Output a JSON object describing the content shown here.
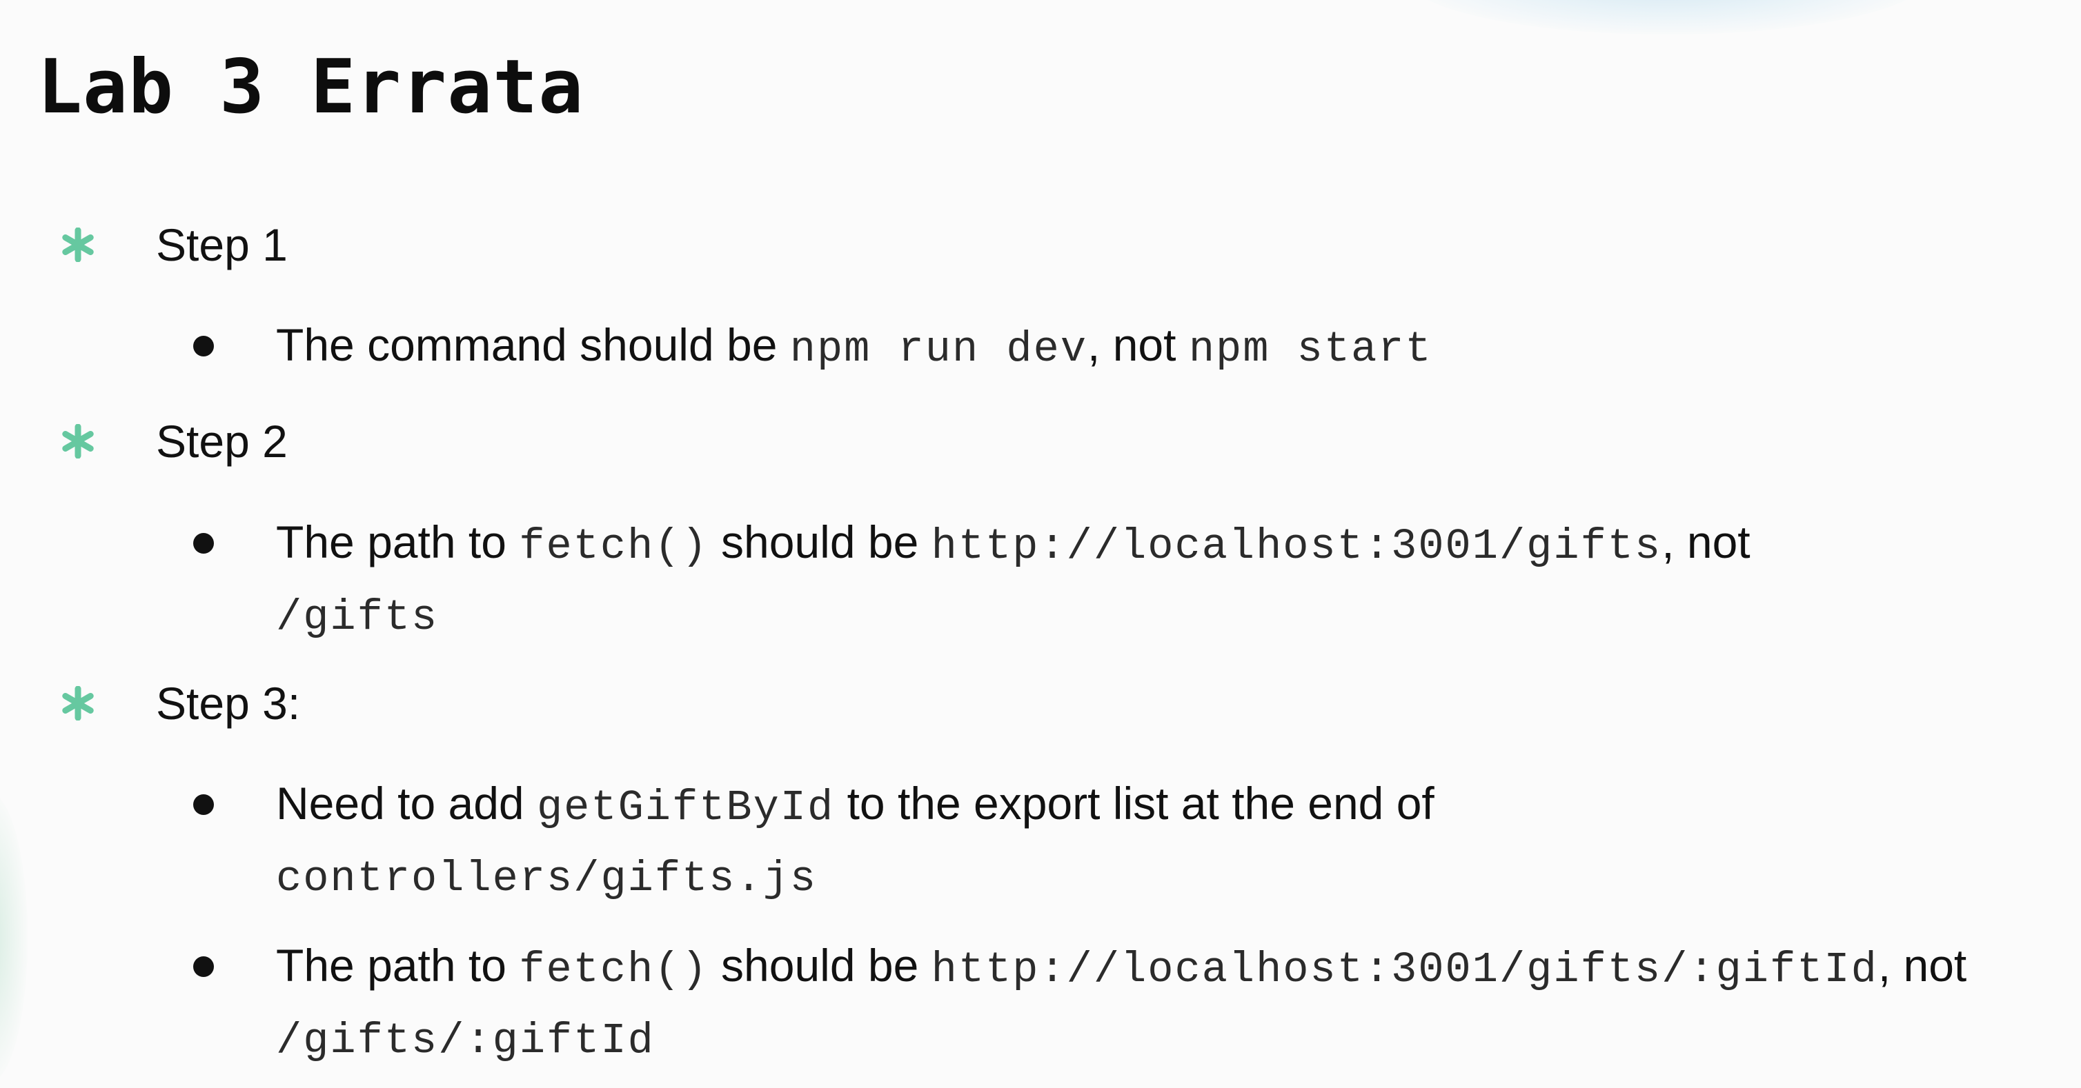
{
  "slide": {
    "title": "Lab 3 Errata",
    "accent_color": "#66c8a0",
    "marker_icon": "asterisk-icon",
    "bullet_icon": "bullet-dot-icon"
  },
  "steps": [
    {
      "label": "Step 1",
      "bullets": [
        {
          "text_1": "The command should be ",
          "code_1": "npm run dev",
          "text_2": ", not ",
          "code_2": "npm start"
        }
      ]
    },
    {
      "label": "Step 2",
      "bullets": [
        {
          "text_1": "The path to ",
          "code_1": "fetch()",
          "text_2": " should be ",
          "code_2": "http://localhost:3001/gifts",
          "text_3": ", not ",
          "code_3": "/gifts"
        }
      ]
    },
    {
      "label": "Step 3:",
      "bullets": [
        {
          "text_1": "Need to add ",
          "code_1": "getGiftById",
          "text_2": " to the export list at the end of ",
          "code_2": "controllers/gifts.js"
        },
        {
          "text_1": "The path to ",
          "code_1": "fetch()",
          "text_2": " should be ",
          "code_2": "http://localhost:3001/gifts/:giftId",
          "text_3": ", not ",
          "code_3": "/gifts/:giftId"
        }
      ]
    }
  ]
}
